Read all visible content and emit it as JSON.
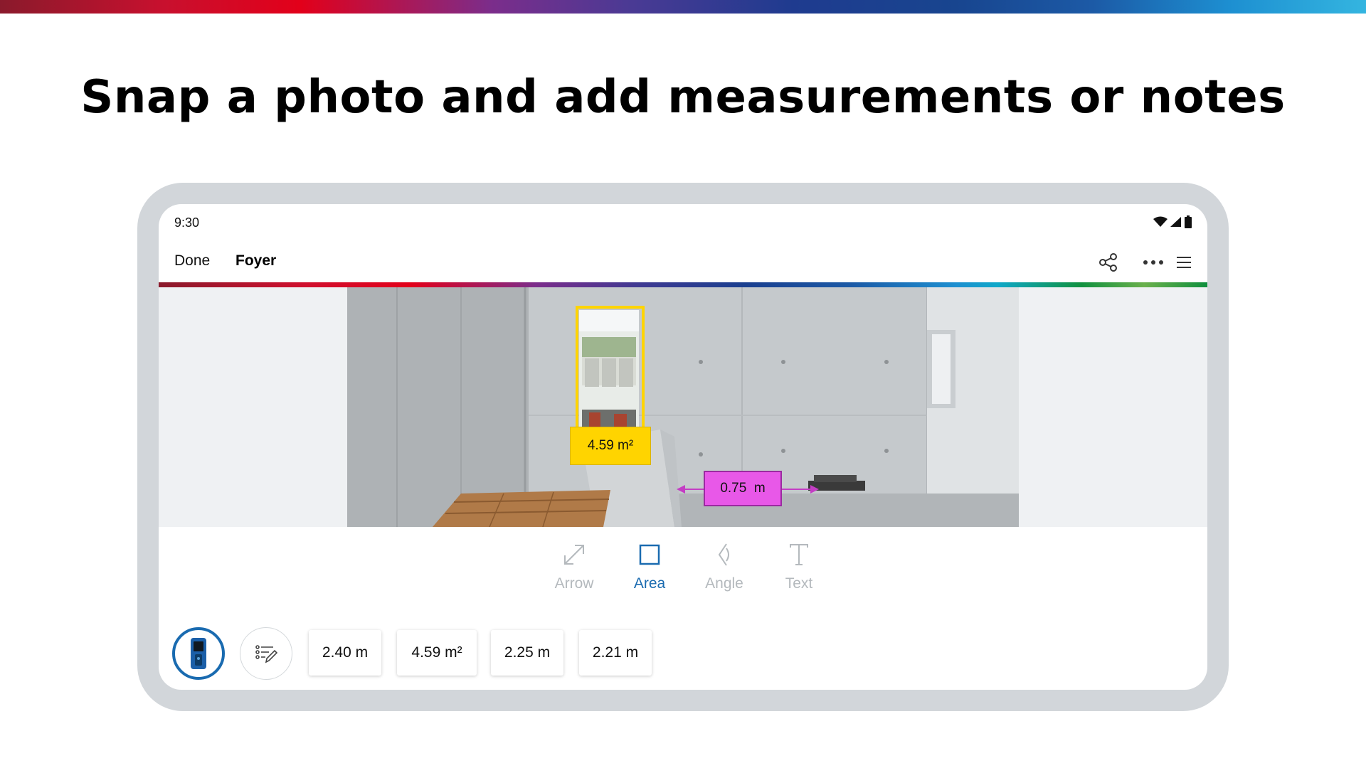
{
  "headline": "Snap a photo and add measurements or notes",
  "status_bar": {
    "time": "9:30"
  },
  "app_bar": {
    "done_label": "Done",
    "title": "Foyer",
    "icons": [
      "share-icon",
      "more-horizontal-icon",
      "menu-icon"
    ]
  },
  "photo": {
    "area_label": "4.59 m²",
    "distance_label": "0.75  m"
  },
  "tools": [
    {
      "label": "Arrow",
      "icon": "arrow-diagonal-icon",
      "active": false
    },
    {
      "label": "Area",
      "icon": "square-icon",
      "active": true
    },
    {
      "label": "Angle",
      "icon": "angle-icon",
      "active": false
    },
    {
      "label": "Text",
      "icon": "text-icon",
      "active": false
    }
  ],
  "measurements": [
    "2.40 m",
    "4.59 m²",
    "2.25 m",
    "2.21 m"
  ],
  "colors": {
    "accent_blue": "#1a6bb0",
    "area_yellow": "#ffd400",
    "distance_magenta": "#e040e0"
  }
}
